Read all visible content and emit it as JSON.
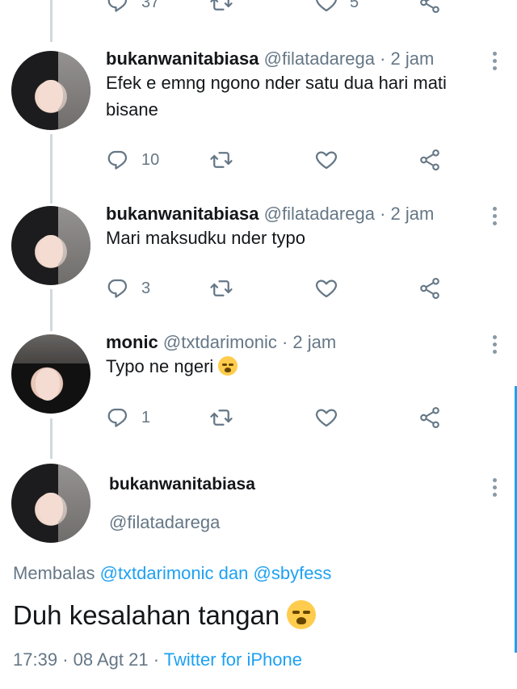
{
  "top_partial": {
    "reply_count": "37",
    "like_count": "5"
  },
  "tweets": [
    {
      "name": "bukanwanitabiasa",
      "handle": "@filatadarega",
      "time": "· 2 jam",
      "text_line1": "Efek e emng ngono nder satu dua hari mati",
      "text_line2": "bisane",
      "reply_count": "10"
    },
    {
      "name": "bukanwanitabiasa",
      "handle": "@filatadarega",
      "time": "· 2 jam",
      "text_line1": "Mari maksudku nder typo",
      "reply_count": "3"
    },
    {
      "name": "monic",
      "handle": "@txtdarimonic",
      "time": "· 2 jam",
      "text_line1": "Typo ne ngeri",
      "emoji": "loudly-crying-face",
      "reply_count": "1"
    }
  ],
  "focused": {
    "name": "bukanwanitabiasa",
    "handle": "@filatadarega",
    "reply_prefix": "Membalas",
    "reply_user1": "@txtdarimonic",
    "reply_join": "dan",
    "reply_user2": "@sbyfess",
    "text": "Duh kesalahan tangan",
    "emoji": "loudly-crying-face",
    "time": "17:39",
    "date": "08 Agt 21",
    "source": "Twitter for iPhone"
  },
  "colors": {
    "accent": "#1da1f2",
    "muted": "#657786",
    "text": "#14171a",
    "line": "#cfd9de"
  },
  "icons": [
    "reply-icon",
    "retweet-icon",
    "like-icon",
    "share-icon",
    "more-icon"
  ]
}
